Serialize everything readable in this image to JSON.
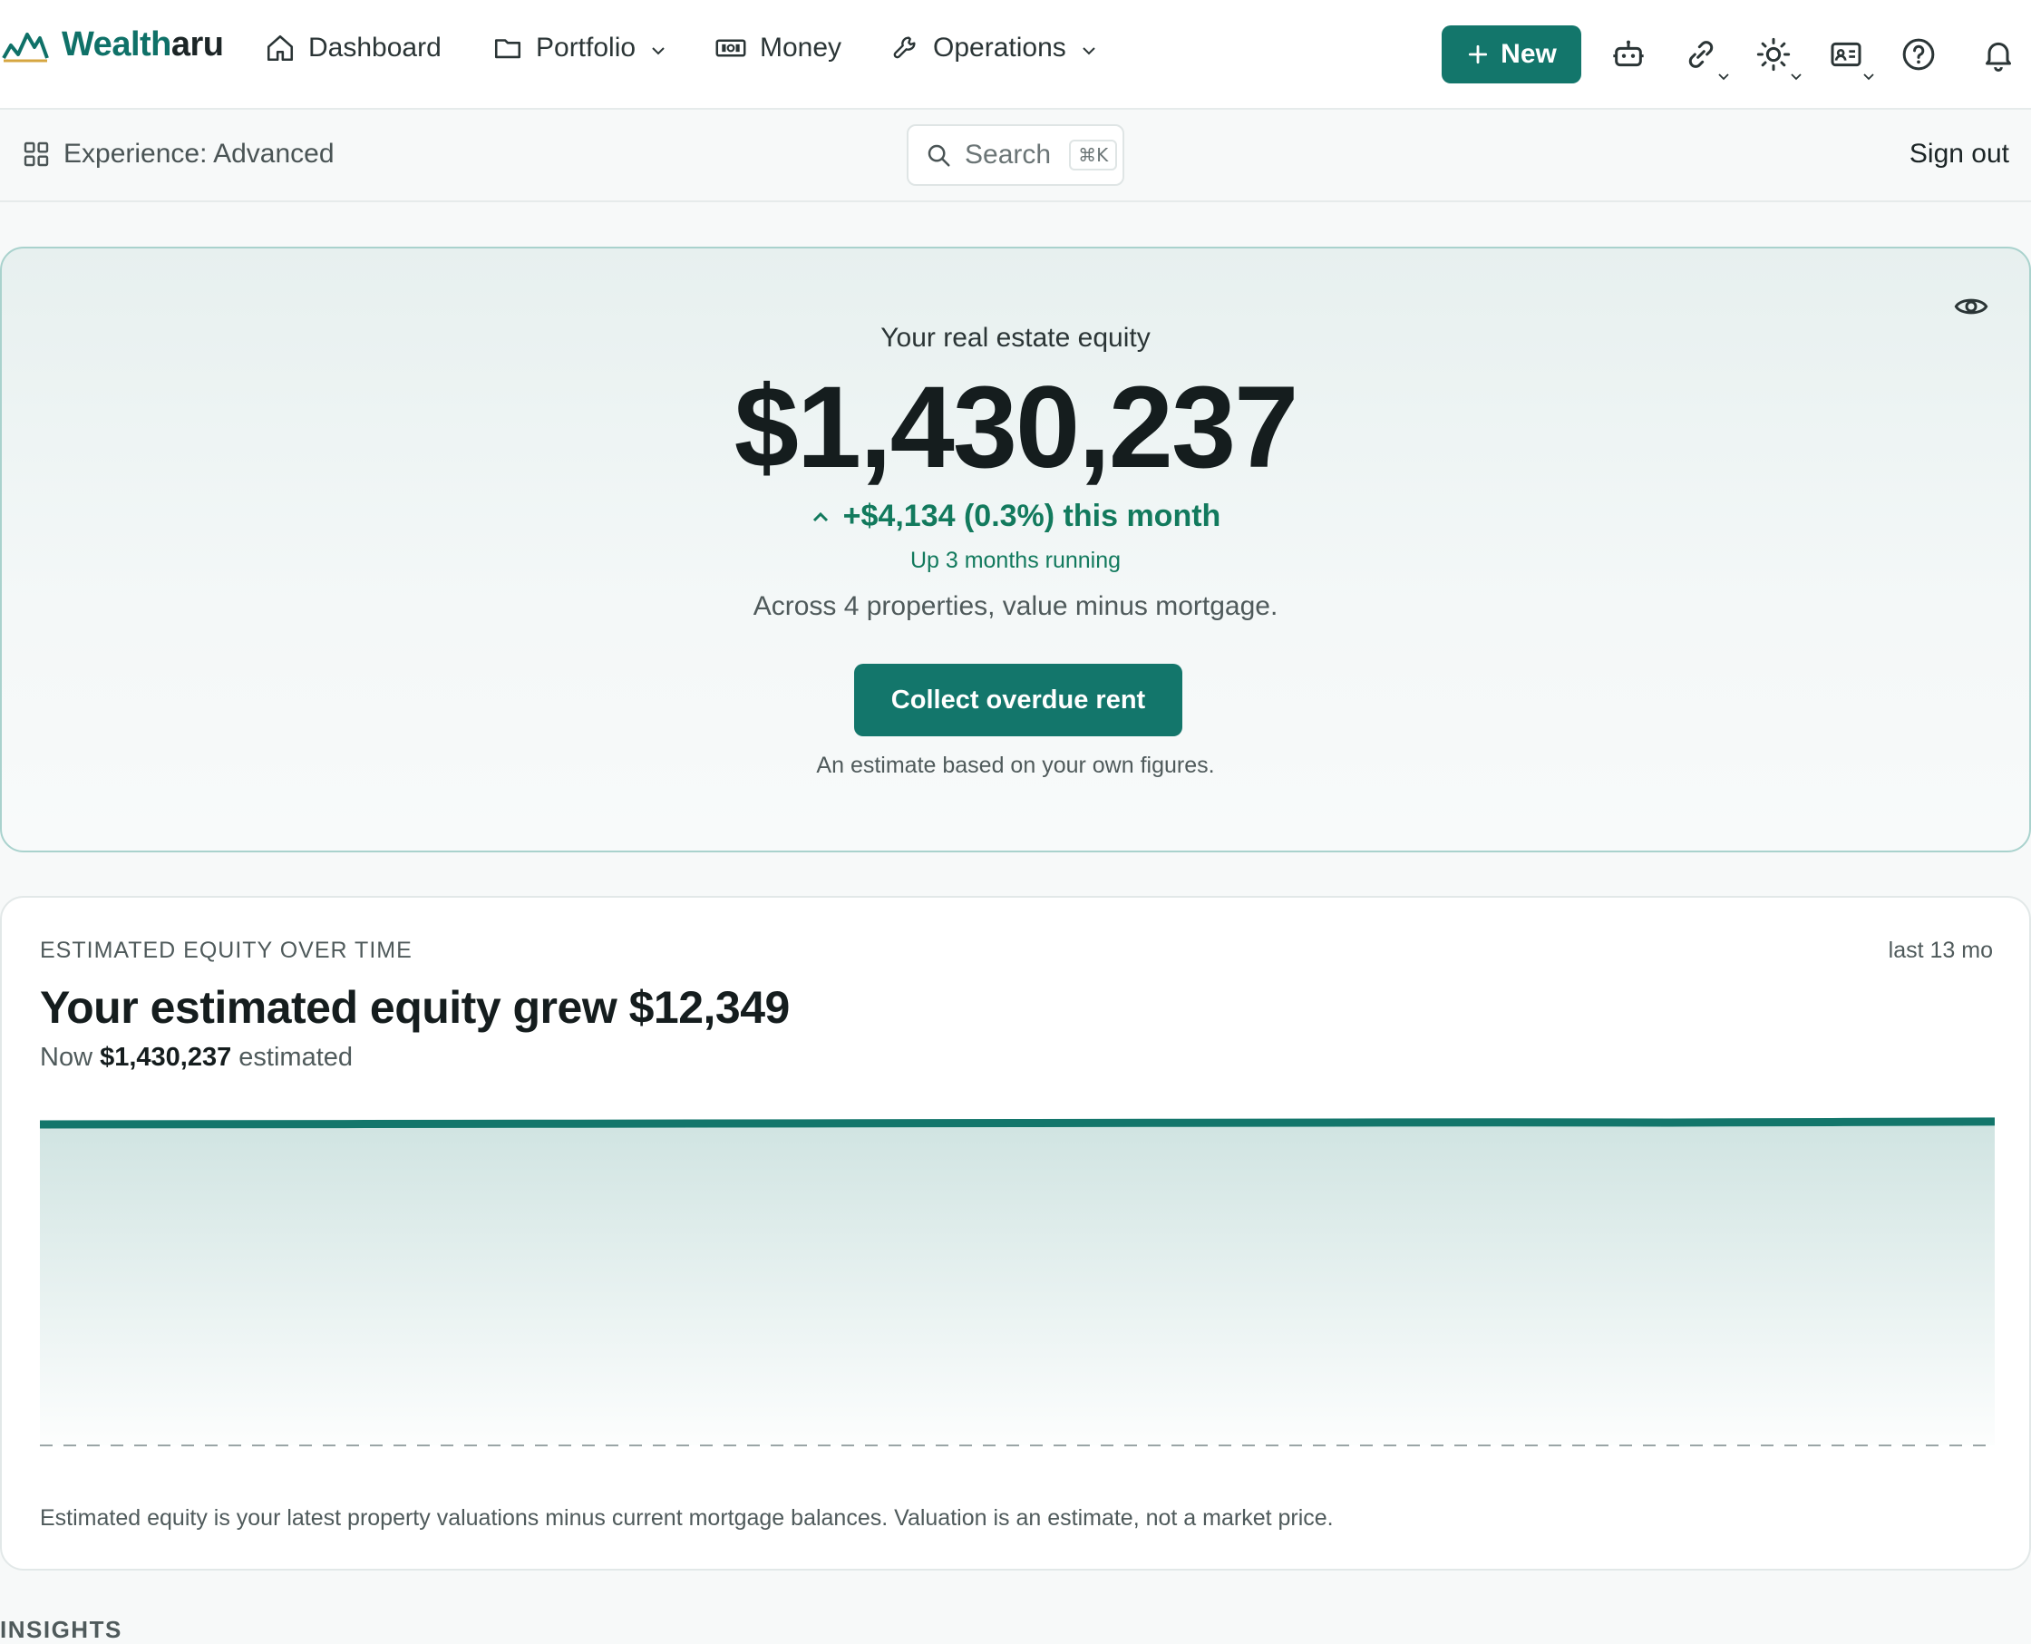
{
  "brand": {
    "name_start": "Wealth",
    "name_end": "aru",
    "logo_icon": "chart-logo-icon"
  },
  "nav": {
    "items": [
      {
        "label": "Dashboard",
        "icon": "home-icon"
      },
      {
        "label": "Portfolio",
        "icon": "folder-icon",
        "has_dropdown": true
      },
      {
        "label": "Money",
        "icon": "cash-icon"
      },
      {
        "label": "Operations",
        "icon": "wrench-icon",
        "has_dropdown": true
      }
    ],
    "new_label": "New",
    "tools": [
      "robot-icon",
      "link-icon",
      "sun-icon",
      "id-card-icon",
      "help-icon",
      "bell-icon"
    ]
  },
  "subbar": {
    "experience_label": "Experience: Advanced",
    "search_label": "Search",
    "search_shortcut": "⌘K",
    "signout_label": "Sign out"
  },
  "hero": {
    "eyebrow": "Your real estate equity",
    "value": "$1,430,237",
    "change": "+$4,134 (0.3%) this month",
    "streak": "Up 3 months running",
    "description": "Across 4 properties, value minus mortgage.",
    "cta": "Collect overdue rent",
    "note": "An estimate based on your own figures."
  },
  "card": {
    "eyebrow": "ESTIMATED EQUITY OVER TIME",
    "range": "last 13 mo",
    "title": "Your estimated equity grew $12,349",
    "sub_prefix": "Now",
    "sub_value": "$1,430,237",
    "sub_suffix": "estimated",
    "footnote": "Estimated equity is your latest property valuations minus current mortgage balances. Valuation is an estimate, not a market price."
  },
  "insights_label": "INSIGHTS",
  "chart_data": {
    "type": "area",
    "title": "",
    "xlabel": "",
    "ylabel": "",
    "x": [
      1,
      2,
      3,
      4,
      5,
      6,
      7,
      8,
      9,
      10,
      11,
      12,
      13
    ],
    "values": [
      1417888,
      1418900,
      1419800,
      1420900,
      1421900,
      1423000,
      1424000,
      1425000,
      1426100,
      1427100,
      1426103,
      1428200,
      1430237
    ],
    "ylim": [
      0,
      1450000
    ],
    "grid": false,
    "baseline": "dashed",
    "color": "#13766b"
  },
  "colors": {
    "accent": "#13766b",
    "positive": "#127a5d"
  }
}
